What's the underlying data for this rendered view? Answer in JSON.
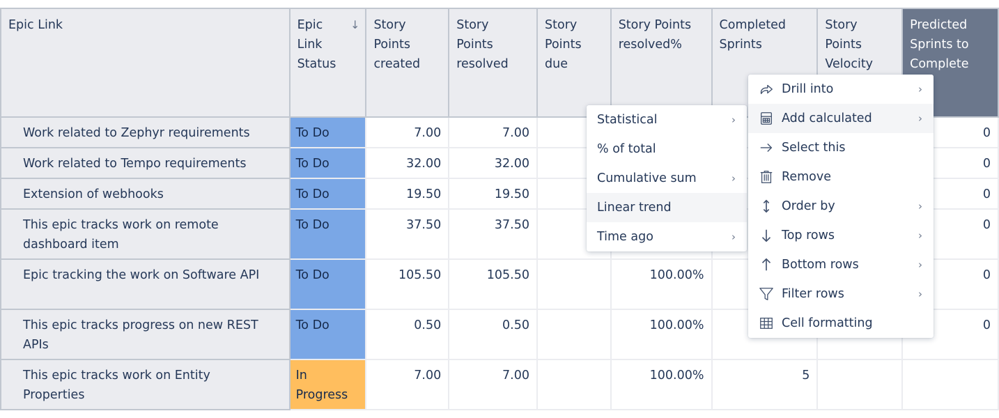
{
  "table": {
    "columns": [
      {
        "label": "Epic Link"
      },
      {
        "label": "Epic Link Status",
        "sort": "↓"
      },
      {
        "label": "Story Points created"
      },
      {
        "label": "Story Points resolved"
      },
      {
        "label": "Story Points due"
      },
      {
        "label": "Story Points resolved%"
      },
      {
        "label": "Completed Sprints"
      },
      {
        "label": "Story Points Velocity"
      },
      {
        "label": "Predicted Sprints to Complete"
      }
    ],
    "rows": [
      {
        "epic": "Work related to Zephyr requirements",
        "status": "To Do",
        "created": "7.00",
        "resolved": "7.00",
        "due": "",
        "resolved_pct": "",
        "completed_sprints": "",
        "velocity": "",
        "predicted": "0"
      },
      {
        "epic": "Work related to Tempo requirements",
        "status": "To Do",
        "created": "32.00",
        "resolved": "32.00",
        "due": "",
        "resolved_pct": "",
        "completed_sprints": "",
        "velocity": "",
        "predicted": "0"
      },
      {
        "epic": "Extension of webhooks",
        "status": "To Do",
        "created": "19.50",
        "resolved": "19.50",
        "due": "",
        "resolved_pct": "",
        "completed_sprints": "",
        "velocity": "",
        "predicted": "0"
      },
      {
        "epic": "This epic tracks work on remote dashboard item",
        "status": "To Do",
        "created": "37.50",
        "resolved": "37.50",
        "due": "",
        "resolved_pct": "",
        "completed_sprints": "",
        "velocity": "",
        "predicted": "0"
      },
      {
        "epic": "Epic tracking the work on Software API",
        "status": "To Do",
        "created": "105.50",
        "resolved": "105.50",
        "due": "",
        "resolved_pct": "100.00%",
        "completed_sprints": "",
        "velocity": "",
        "predicted": "0"
      },
      {
        "epic": "This epic tracks progress on new REST APIs",
        "status": "To Do",
        "created": "0.50",
        "resolved": "0.50",
        "due": "",
        "resolved_pct": "100.00%",
        "completed_sprints": "",
        "velocity": "",
        "predicted": "0"
      },
      {
        "epic": "This epic tracks work on Entity Properties",
        "status": "In Progress",
        "created": "7.00",
        "resolved": "7.00",
        "due": "",
        "resolved_pct": "100.00%",
        "completed_sprints": "5",
        "velocity": "",
        "predicted": ""
      }
    ]
  },
  "status_colors": {
    "To Do": "#7aa7e6",
    "In Progress": "#ffbe5e"
  },
  "context_menu": {
    "items": [
      {
        "label": "Drill into",
        "icon": "drill-into-icon",
        "submenu": true
      },
      {
        "label": "Add calculated",
        "icon": "calculator-icon",
        "submenu": true,
        "active": true
      },
      {
        "label": "Select this",
        "icon": "arrow-right-icon",
        "submenu": false
      },
      {
        "label": "Remove",
        "icon": "trash-icon",
        "submenu": false
      },
      {
        "label": "Order by",
        "icon": "sort-icon",
        "submenu": true
      },
      {
        "label": "Top rows",
        "icon": "arrow-down-icon",
        "submenu": true
      },
      {
        "label": "Bottom rows",
        "icon": "arrow-up-icon",
        "submenu": true
      },
      {
        "label": "Filter rows",
        "icon": "filter-icon",
        "submenu": true
      },
      {
        "label": "Cell formatting",
        "icon": "grid-icon",
        "submenu": false
      }
    ],
    "chevron": "›"
  },
  "calculated_submenu": {
    "items": [
      {
        "label": "Statistical",
        "submenu": true
      },
      {
        "label": "% of total",
        "submenu": false
      },
      {
        "label": "Cumulative sum",
        "submenu": true
      },
      {
        "label": "Linear trend",
        "submenu": false,
        "active": true
      },
      {
        "label": "Time ago",
        "submenu": true
      }
    ]
  }
}
